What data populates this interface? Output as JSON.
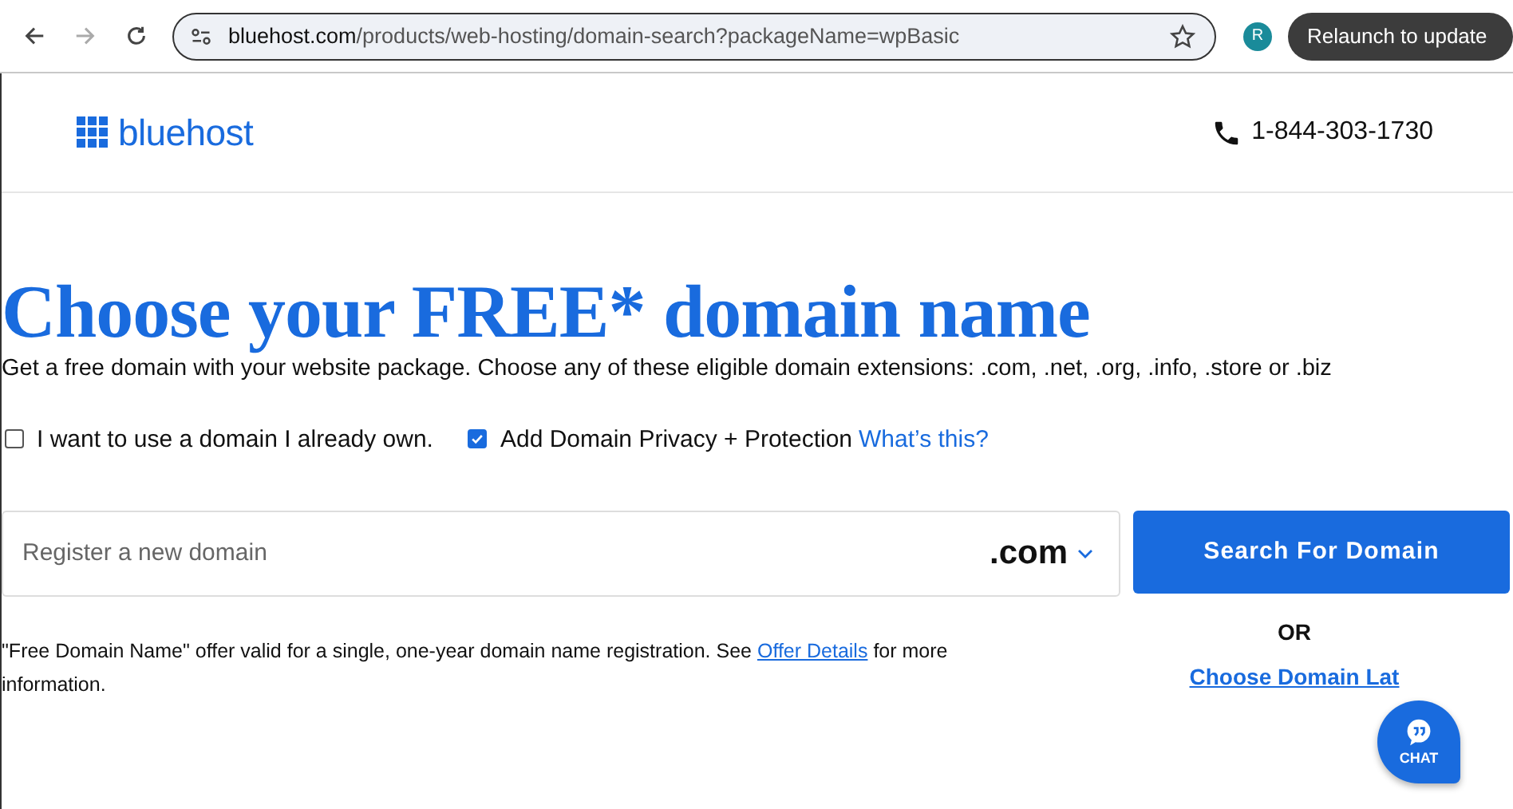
{
  "browser": {
    "url_host": "bluehost.com",
    "url_path": "/products/web-hosting/domain-search?packageName=wpBasic",
    "profile_initial": "R",
    "update_button": "Relaunch to update"
  },
  "header": {
    "logo": "bluehost",
    "phone": "1-844-303-1730"
  },
  "heading": "Choose your FREE* domain name",
  "subtitle": "Get a free domain with your website package. Choose any of these eligible domain extensions: .com, .net, .org, .info, .store or .biz",
  "options": [
    {
      "label": "I want to use a domain I already own.",
      "checked": false
    },
    {
      "label": "Add Domain Privacy + Protection",
      "checked": true,
      "link": "What’s this?"
    }
  ],
  "search": {
    "placeholder": "Register a new domain",
    "extension": ".com",
    "button": "Search For Domain"
  },
  "note": {
    "text": "\"Free Domain Name\" offer valid for a single, one-year domain name registration. See ",
    "link": "Offer Details",
    "after": " for more information."
  },
  "or": "OR",
  "later_link": "Choose Domain Lat",
  "chat": "CHAT"
}
